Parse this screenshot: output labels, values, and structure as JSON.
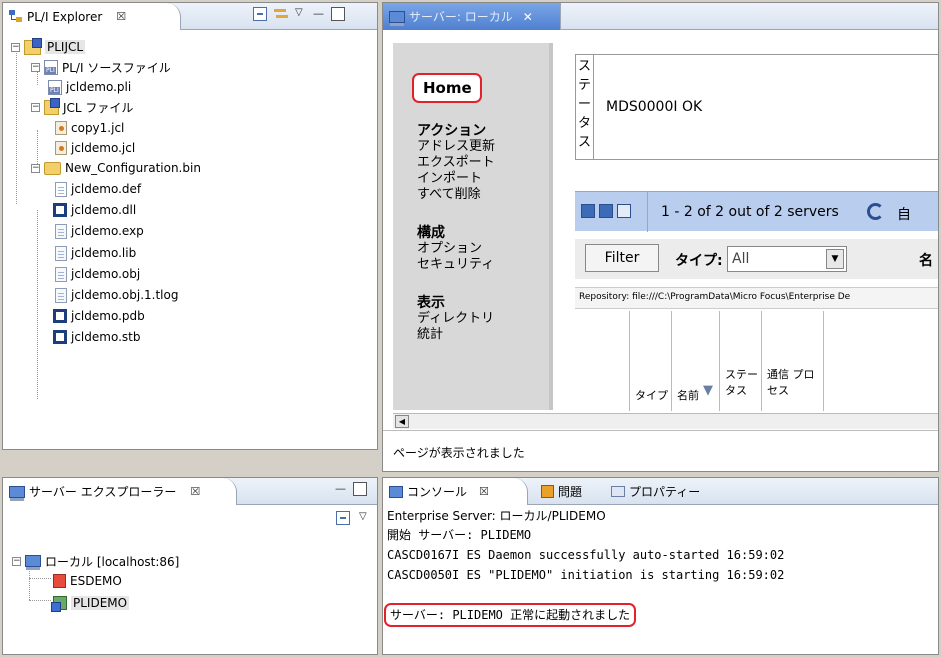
{
  "explorer": {
    "tab_label": "PL/I Explorer",
    "tab_close": "☒",
    "tree": [
      {
        "label": "PLIJCL",
        "kind": "project"
      },
      {
        "label": "PL/I ソースファイル",
        "kind": "pli-folder"
      },
      {
        "label": "jcldemo.pli",
        "kind": "pli"
      },
      {
        "label": "JCL ファイル",
        "kind": "jcl-folder"
      },
      {
        "label": "copy1.jcl",
        "kind": "jcl"
      },
      {
        "label": "jcldemo.jcl",
        "kind": "jcl"
      },
      {
        "label": "New_Configuration.bin",
        "kind": "folder"
      },
      {
        "label": "jcldemo.def",
        "kind": "blank"
      },
      {
        "label": "jcldemo.dll",
        "kind": "dll"
      },
      {
        "label": "jcldemo.exp",
        "kind": "doc"
      },
      {
        "label": "jcldemo.lib",
        "kind": "doc"
      },
      {
        "label": "jcldemo.obj",
        "kind": "doc"
      },
      {
        "label": "jcldemo.obj.1.tlog",
        "kind": "doc"
      },
      {
        "label": "jcldemo.pdb",
        "kind": "dll"
      },
      {
        "label": "jcldemo.stb",
        "kind": "dll"
      }
    ]
  },
  "server_editor": {
    "tab_label": "サーバー: ローカル",
    "tab_close": "✕",
    "nav": {
      "home": "Home",
      "actions_heading": "アクション",
      "actions": [
        "アドレス更新",
        "エクスポート",
        "インポート",
        "すべて削除"
      ],
      "config_heading": "構成",
      "config": [
        "オプション",
        "セキュリティ"
      ],
      "view_heading": "表示",
      "view": [
        "ディレクトリ",
        "統計"
      ]
    },
    "status_label_chars": [
      "ス",
      "テ",
      "ー",
      "タ",
      "ス"
    ],
    "status_value": "MDS0000I OK",
    "pager_text": "1 - 2 of 2 out of 2 servers",
    "pager_next": "自",
    "filter_button": "Filter",
    "type_label": "タイプ:",
    "type_value": "All",
    "name_label": "名",
    "repository_text": "Repository: file:///C:\\ProgramData\\Micro Focus\\Enterprise De",
    "columns": [
      "タイプ",
      "名前",
      "ステータス",
      "通信 プロセス"
    ],
    "status_bar": "ページが表示されました"
  },
  "server_explorer": {
    "tab_label": "サーバー エクスプローラー",
    "tab_close": "☒",
    "root": "ローカル [localhost:86]",
    "servers": [
      "ESDEMO",
      "PLIDEMO"
    ]
  },
  "console": {
    "tabs": [
      "コンソール",
      "問題",
      "プロパティー"
    ],
    "tab_close": "☒",
    "header": "Enterprise Server: ローカル/PLIDEMO",
    "lines": [
      "開始 サーバー: PLIDEMO",
      "CASCD0167I ES Daemon successfully auto-started 16:59:02",
      "CASCD0050I ES \"PLIDEMO\" initiation is starting 16:59:02"
    ],
    "started_line": "サーバー: PLIDEMO 正常に起動されました"
  },
  "colors": {
    "highlight_red": "#e0222a",
    "active_tab_blue": "#4f7fd0",
    "table_toolbar_blue": "#b9cdee"
  }
}
